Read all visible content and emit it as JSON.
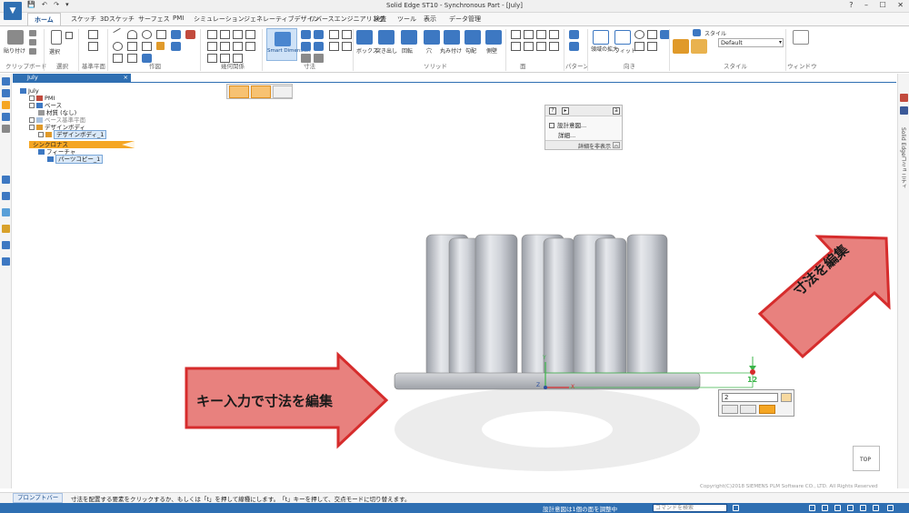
{
  "app": {
    "title": "Solid Edge ST10 - Synchronous Part - [July]",
    "app_button": "▼",
    "qat": [
      "💾",
      "↶",
      "↷",
      "▾"
    ]
  },
  "tabs": [
    "ホーム",
    "スケッチ",
    "3Dスケッチ",
    "サーフェス",
    "PMI",
    "シミュレーション",
    "ジェネレーティブデザイン",
    "リバースエンジニアリング",
    "検査",
    "ツール",
    "表示",
    "データ管理"
  ],
  "ribbon": {
    "groups": [
      "クリップボード",
      "選択",
      "基準平面",
      "作図",
      "幾何関係",
      "寸法",
      "ソリッド",
      "面",
      "パターン",
      "向き",
      "スタイル",
      "ウィンドウ"
    ],
    "paste": "貼り付け",
    "select": "選択",
    "smart_dimension": "Smart Dimension",
    "solid_labels": [
      "ボックス",
      "突き出し",
      "回転",
      "穴",
      "丸み付け",
      "勾配",
      "側壁"
    ],
    "view_labels": [
      "領域の拡大",
      "フィット"
    ],
    "style_label": "スタイル",
    "style_value": "Default"
  },
  "document_tab": "July",
  "tree": [
    {
      "label": "July"
    },
    {
      "label": "PMI"
    },
    {
      "label": "ベース"
    },
    {
      "label": "材質 (なし)"
    },
    {
      "label": "ベース基準平面"
    },
    {
      "label": "デザインボディ"
    },
    {
      "label": "デザインボディ_1"
    },
    {
      "label": "シンクロナス"
    },
    {
      "label": "フィーチャ"
    },
    {
      "label": "パーツコピー_1"
    }
  ],
  "intent_panel": {
    "items": [
      "設計意図...",
      "詳細..."
    ],
    "hide_details": "詳細を非表示"
  },
  "right_sidebar": "Solid Edgeコミュニティ",
  "callouts": {
    "left": "キー入力で寸法を編集",
    "right": "寸法を編集"
  },
  "dimension": {
    "input_value": "2",
    "label": "12"
  },
  "axis": {
    "y": "Y",
    "z": "Z",
    "x": "X"
  },
  "viewcube": "TOP",
  "status": {
    "prompt_label": "プロンプトバー",
    "prompt_text": "寸法を配置する要素をクリックするか、もしくは「t」を押して線種にします。　「t」キーを押して、交点モードに切り替えます。",
    "copyright": "Copyright(C)2018 SIEMENS PLM Software CO., LTD. All Rights Reserved",
    "bottom_msg": "設計意図は1個の面を調整中",
    "command_search": "コマンドを検索"
  },
  "colors": {
    "accent": "#2f6fb2",
    "highlight": "#f5a623",
    "callout": "#e8817e",
    "callout_border": "#d62c2c"
  }
}
